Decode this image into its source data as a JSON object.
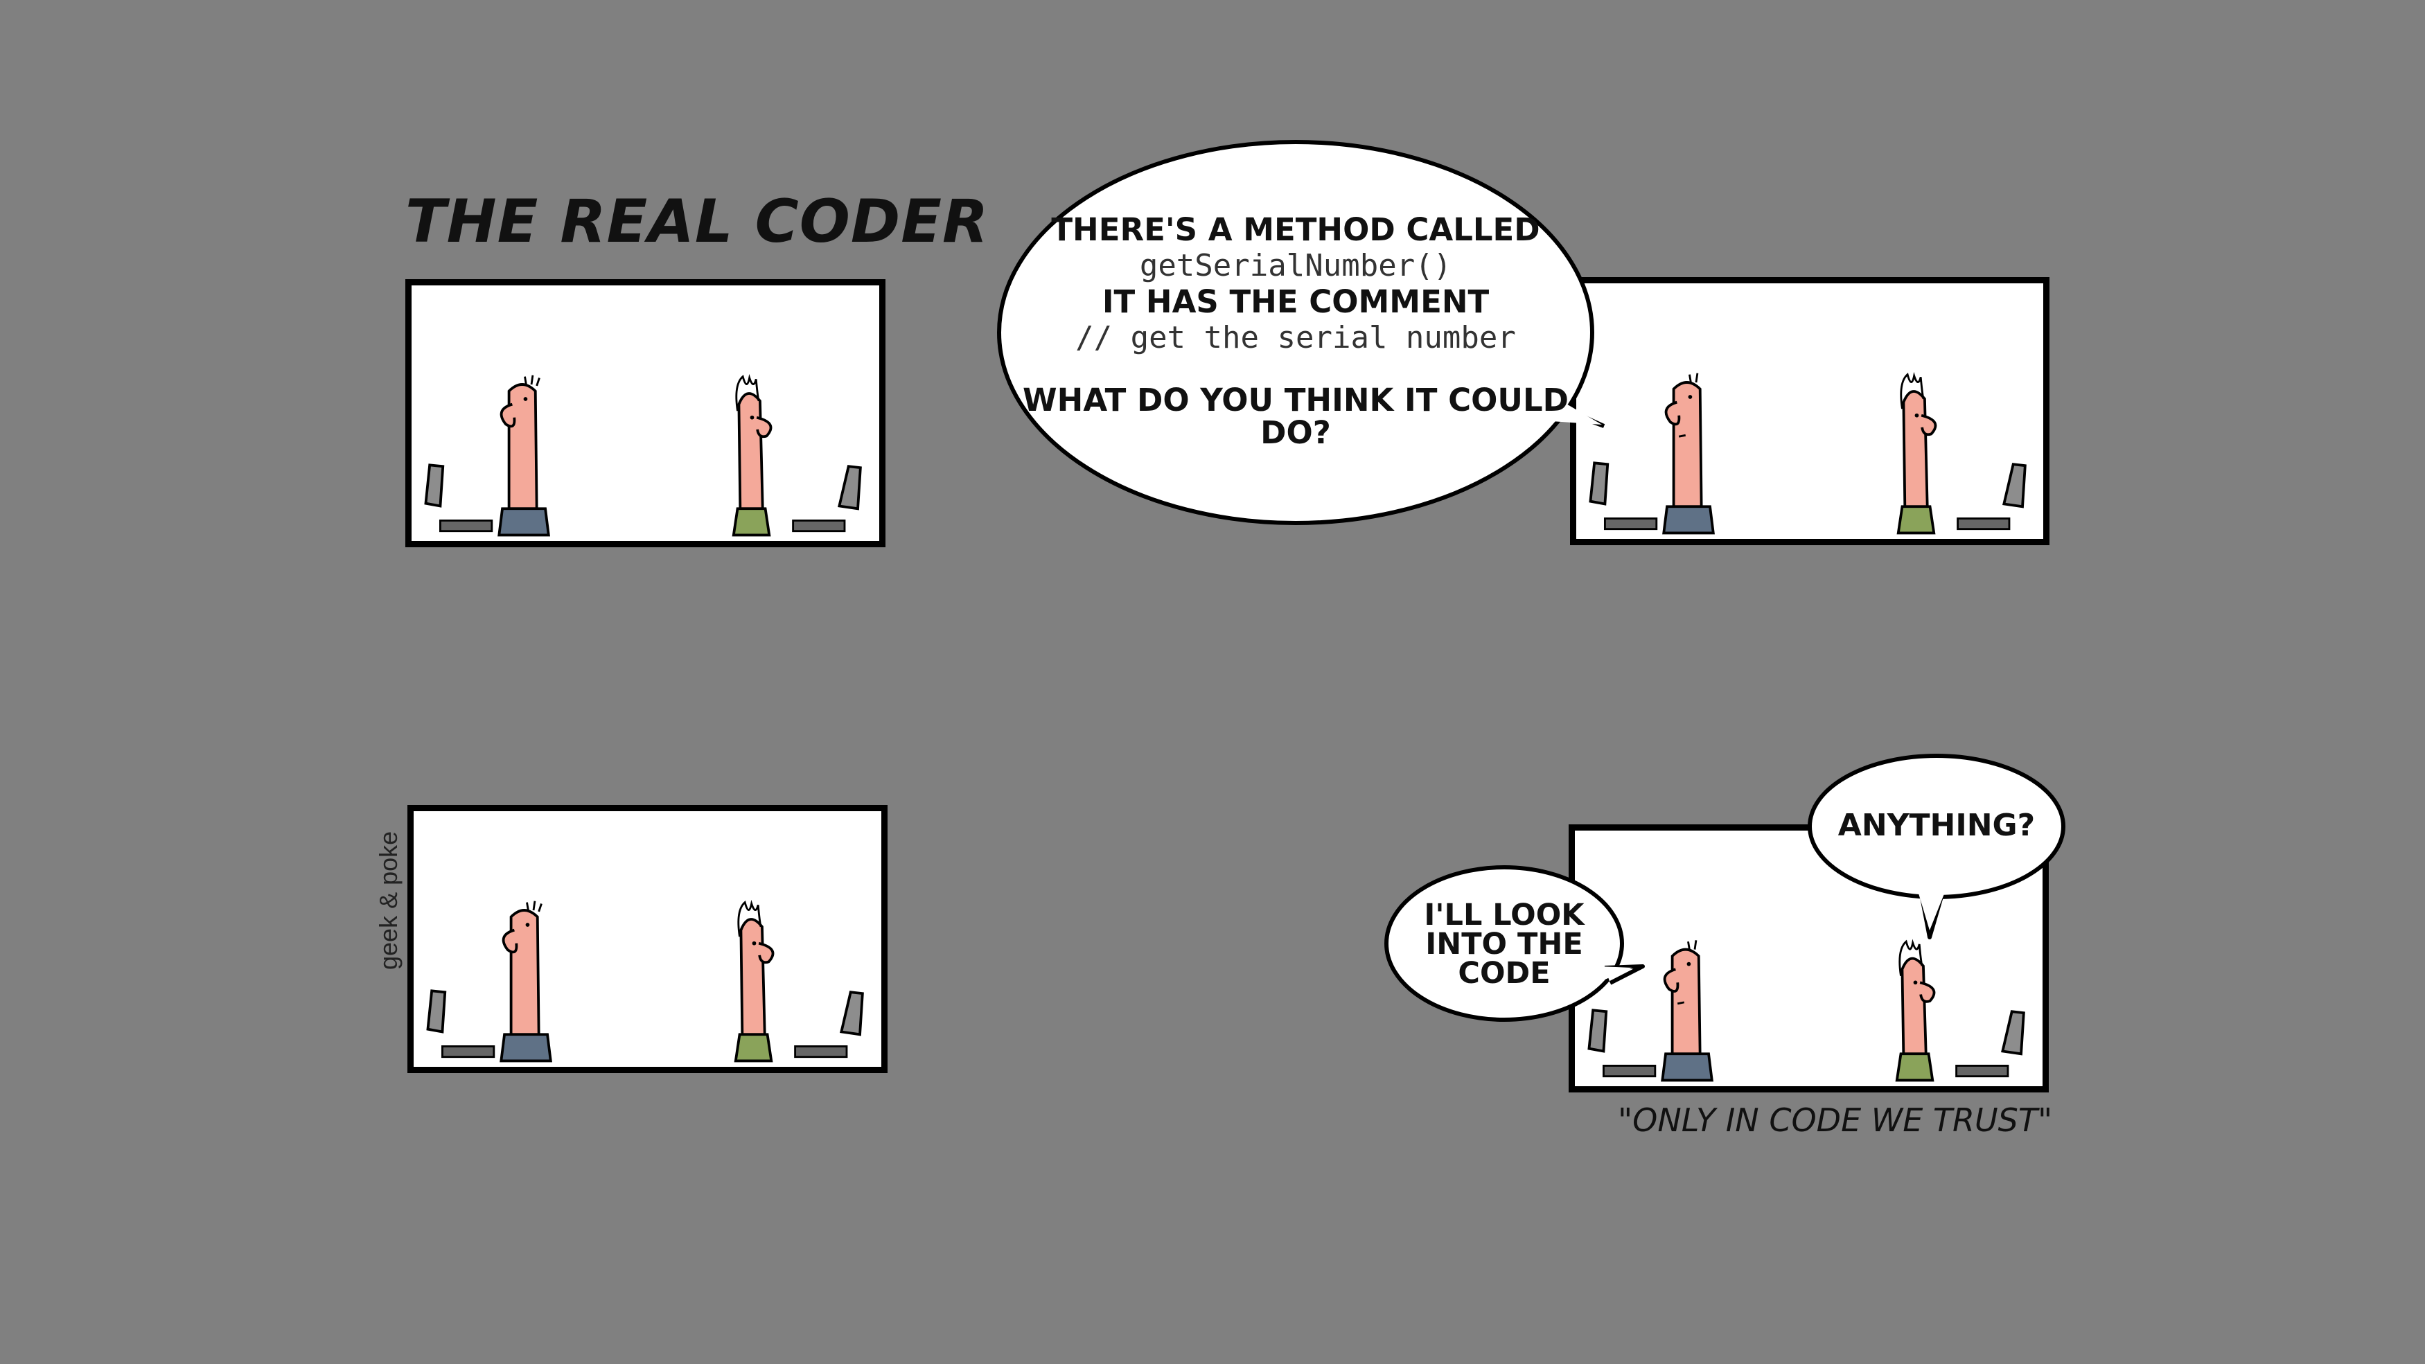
{
  "comic": {
    "title": "THE REAL CODER",
    "signature": "geek & poke",
    "caption": "\"ONLY IN CODE WE TRUST\"",
    "colors": {
      "background": "#808080",
      "panel": "#ffffff",
      "skin": "#f4a99a",
      "shirt_left": "#5f7186",
      "shirt_right": "#8aa35a",
      "monitor": "#8d8d8d"
    },
    "panel2_bubble": {
      "line1": "THERE'S A METHOD CALLED",
      "line2": "getSerialNumber()",
      "line3": "IT HAS THE COMMENT",
      "line4": "// get the serial number",
      "line5": "WHAT DO YOU THINK IT COULD",
      "line6": "DO?"
    },
    "panel4_bubble_left": {
      "line1": "I'LL LOOK",
      "line2": "INTO THE",
      "line3": "CODE"
    },
    "panel4_bubble_right": {
      "line1": "ANYTHING?"
    }
  }
}
